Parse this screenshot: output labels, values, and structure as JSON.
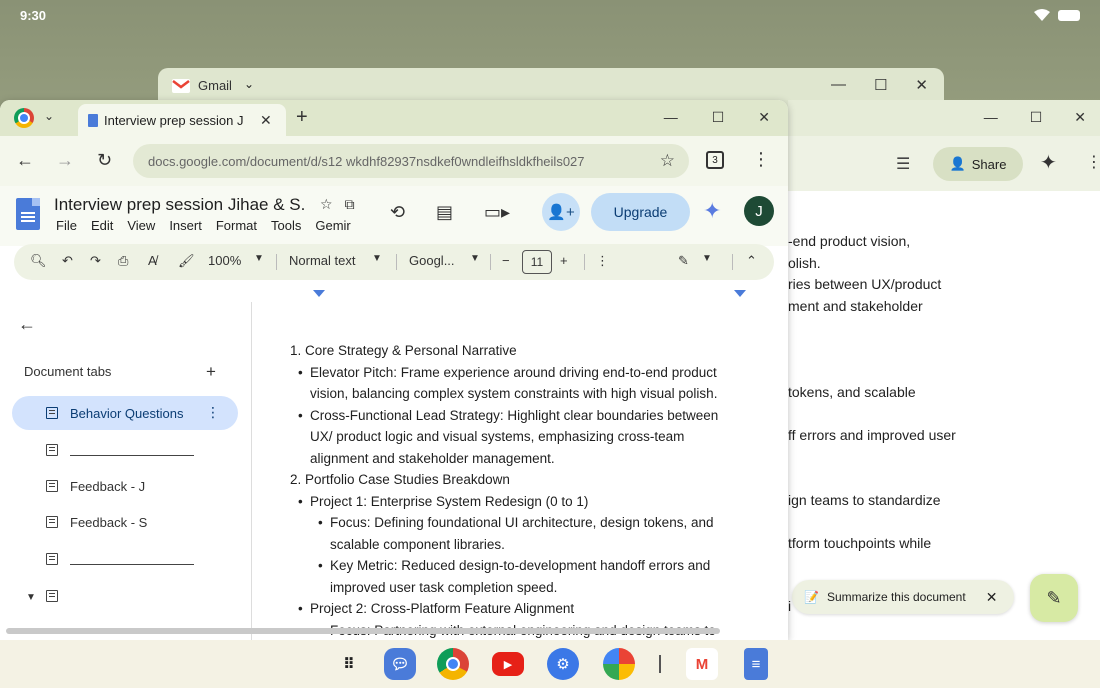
{
  "status": {
    "time": "9:30"
  },
  "gmail_window": {
    "title": "Gmail"
  },
  "tab": {
    "title": "Interview prep session J",
    "close": "✕"
  },
  "address": {
    "url": "docs.google.com/document/d/s12 wkdhf82937nsdkef0wndleifhsldkfheils027",
    "tab_count": "3"
  },
  "doc": {
    "title": "Interview prep session Jihae & S...",
    "menu": [
      "File",
      "Edit",
      "View",
      "Insert",
      "Format",
      "Tools",
      "Gemir"
    ],
    "upgrade_label": "Upgrade",
    "avatar_letter": "J"
  },
  "bg_window": {
    "share_label": "Share",
    "lines": [
      "-end product vision,",
      "olish.",
      "ries between UX/product",
      "ment and stakeholder",
      "tokens, and scalable",
      "ff errors and improved user",
      "ign teams to standardize",
      "tform touchpoints while",
      "i"
    ]
  },
  "toolbar": {
    "zoom": "100%",
    "style": "Normal text",
    "font": "Googl...",
    "minus": "−",
    "font_size": "11",
    "plus": "+"
  },
  "sidebar": {
    "label": "Document tabs",
    "items": [
      {
        "label": "Behavior Questions"
      },
      {
        "label": ""
      },
      {
        "label": "Feedback - J"
      },
      {
        "label": "Feedback - S"
      },
      {
        "label": ""
      },
      {
        "label": ""
      }
    ]
  },
  "content": {
    "h1": "1. Core Strategy & Personal Narrative",
    "b1": "Elevator Pitch: Frame experience around driving end-to-end product vision, balancing complex system constraints with high visual polish.",
    "b2": "Cross-Functional Lead Strategy: Highlight clear boundaries between UX/ product logic and visual systems, emphasizing cross-team alignment and stakeholder management.",
    "h2": "2. Portfolio Case Studies Breakdown",
    "p1": "Project 1: Enterprise System Redesign (0 to 1)",
    "p1a": "Focus: Defining foundational UI architecture, design tokens, and scalable component libraries.",
    "p1b": "Key Metric: Reduced design-to-development handoff errors and improved user task completion speed.",
    "p2": "Project 2: Cross-Platform Feature Alignment",
    "p2a": "Focus: Partnering with external engineering and design teams to"
  },
  "summarize": {
    "label": "Summarize this document"
  }
}
